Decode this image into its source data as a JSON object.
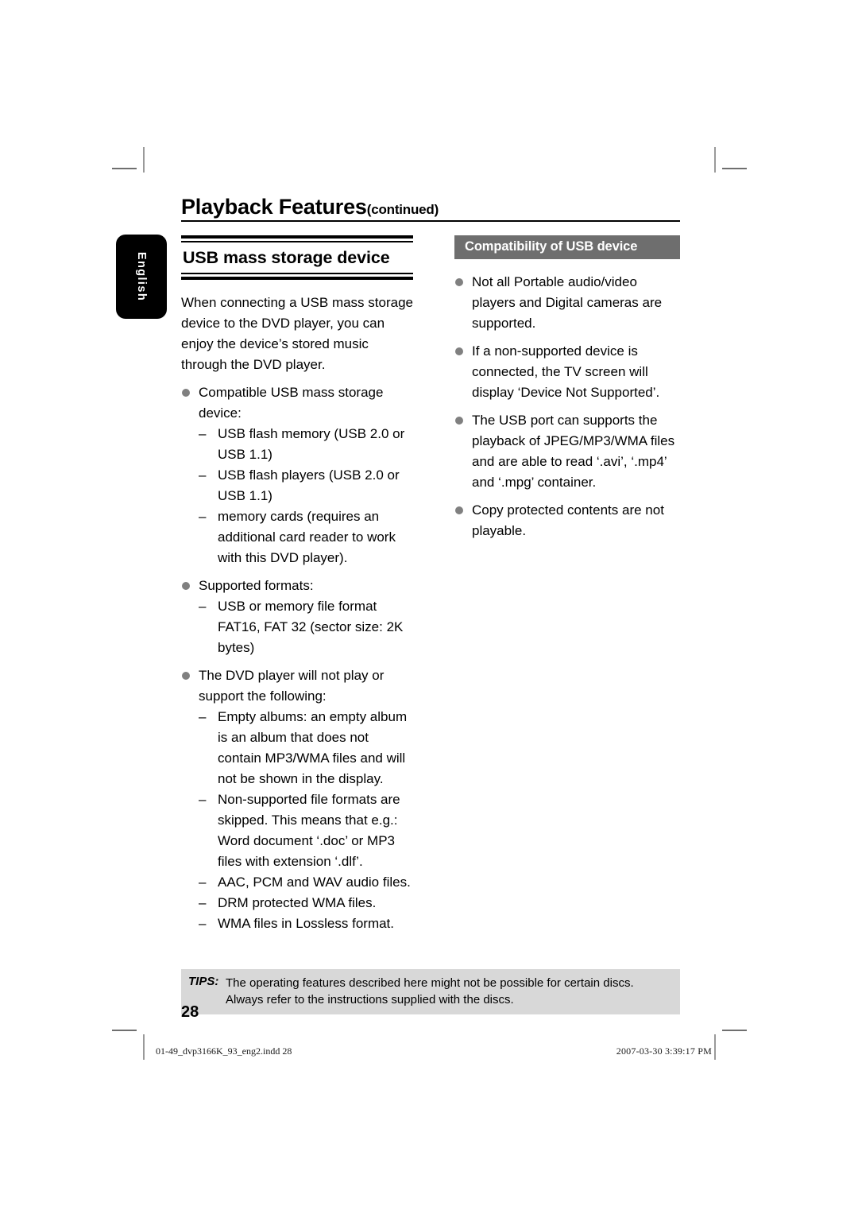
{
  "document": {
    "running_head": {
      "title": "Playback Features",
      "continued": "(continued)"
    },
    "language_tab": "English",
    "page_number": "28"
  },
  "left_column": {
    "section_title_strong": "USB",
    "section_title_rest": " mass storage device",
    "intro_paragraph": "When connecting a USB mass storage device to the DVD player, you can enjoy the device’s stored music through the DVD player.",
    "bullets": [
      {
        "text": "Compatible USB mass storage device:",
        "sub": [
          "USB flash memory (USB 2.0 or USB 1.1)",
          "USB flash players (USB 2.0 or USB 1.1)",
          "memory cards (requires an additional card reader to work with this DVD player)."
        ]
      },
      {
        "text": "Supported formats:",
        "sub": [
          "USB or memory file format FAT16, FAT 32 (sector size: 2K bytes)"
        ]
      },
      {
        "text": "The DVD player will not play or support the following:",
        "sub": [
          "Empty albums: an empty album is an album that does not contain MP3/WMA files and will not be shown in the display.",
          "Non-supported file formats are skipped. This means that e.g.: Word document ‘.doc’ or MP3 files with extension ‘.dlf’.",
          "AAC, PCM and WAV audio files.",
          "DRM protected WMA files.",
          "WMA files in Lossless format."
        ]
      }
    ]
  },
  "right_column": {
    "header_bar": "Compatibility of USB device",
    "bullets": [
      "Not all Portable audio/video players and Digital cameras are supported.",
      "If a non-supported device is connected, the TV screen will display ‘Device Not Supported’.",
      "The USB port can supports the playback of JPEG/MP3/WMA files and are able to read ‘.avi’, ‘.mp4’ and ‘.mpg’ container.",
      "Copy protected contents are not playable."
    ]
  },
  "tips": {
    "label": "TIPS:",
    "line1": "The operating features described here might not be possible for certain discs.",
    "line2": "Always refer to the instructions supplied with the discs."
  },
  "print_footer": {
    "filename": "01-49_dvp3166K_93_eng2.indd   28",
    "timestamp": "2007-03-30   3:39:17 PM"
  },
  "colors": {
    "gray_bar": "#6e6e6e",
    "bullet": "#808080",
    "tips_bg": "#d8d8d8",
    "tab_bg": "#000000"
  }
}
